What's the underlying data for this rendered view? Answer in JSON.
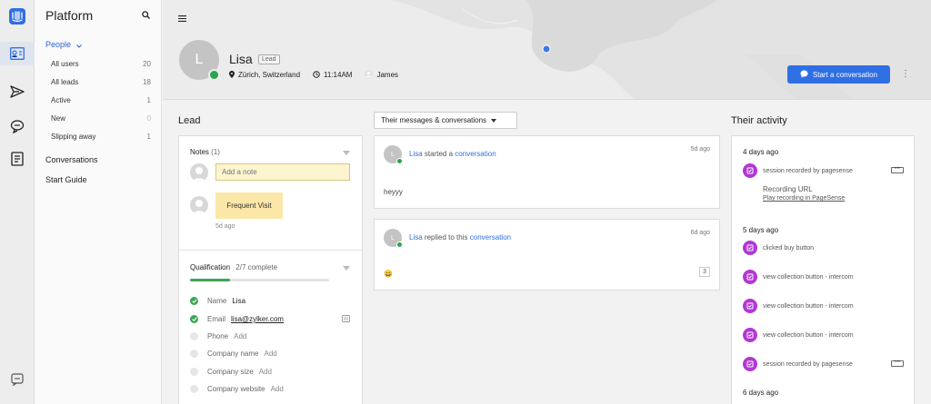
{
  "sidebar": {
    "title": "Platform",
    "people_label": "People",
    "items": [
      {
        "label": "All users",
        "count": "20"
      },
      {
        "label": "All leads",
        "count": "18"
      },
      {
        "label": "Active",
        "count": "1"
      },
      {
        "label": "New",
        "count": "0"
      },
      {
        "label": "Slipping away",
        "count": "1"
      }
    ],
    "links": [
      "Conversations",
      "Start Guide"
    ]
  },
  "profile": {
    "avatar_initial": "L",
    "name": "Lisa",
    "badge": "Lead",
    "location": "Zürich, Switzerland",
    "time": "11:14AM",
    "owner": "James",
    "start_button": "Start a conversation"
  },
  "lead": {
    "title": "Lead",
    "notes_label": "Notes",
    "notes_count": "(1)",
    "note_placeholder": "Add a note",
    "note_text": "Frequent Visit",
    "note_time": "5d ago",
    "qualification_label": "Qualification",
    "qualification_status": "2/7 complete",
    "qualification_progress": 0.2857,
    "fields": [
      {
        "label": "Name",
        "value": "Lisa",
        "done": true
      },
      {
        "label": "Email",
        "value": "lisa@zylker.com",
        "done": true
      },
      {
        "label": "Phone",
        "value": "Add",
        "done": false
      },
      {
        "label": "Company name",
        "value": "Add",
        "done": false
      },
      {
        "label": "Company size",
        "value": "Add",
        "done": false
      },
      {
        "label": "Company website",
        "value": "Add",
        "done": false
      }
    ]
  },
  "conversations": {
    "filter": "Their messages & conversations",
    "items": [
      {
        "avatar": "L",
        "name": "Lisa",
        "action": "started a",
        "link": "conversation",
        "time": "5d ago",
        "body": "heyyy",
        "count": ""
      },
      {
        "avatar": "L",
        "name": "Lisa",
        "action": "replied to this",
        "link": "conversation",
        "time": "6d ago",
        "body": "😄",
        "count": "3"
      }
    ]
  },
  "activity": {
    "title": "Their activity",
    "groups": [
      {
        "day": "4 days ago",
        "events": [
          {
            "text": "session recorded by pagesense",
            "more": "•••",
            "sub": "Recording URL",
            "link": "Play recording in PageSense"
          }
        ]
      },
      {
        "day": "5 days ago",
        "events": [
          {
            "text": "clicked buy button"
          },
          {
            "text": "view collection button - intercom"
          },
          {
            "text": "view collection button - intercom"
          },
          {
            "text": "view collection button - intercom"
          },
          {
            "text": "session recorded by pagesense",
            "more": "•••"
          }
        ]
      },
      {
        "day": "6 days ago",
        "events": []
      }
    ]
  },
  "colors": {
    "accent": "#2f6fe4",
    "online": "#2da44e",
    "activity": "#b238d4"
  }
}
